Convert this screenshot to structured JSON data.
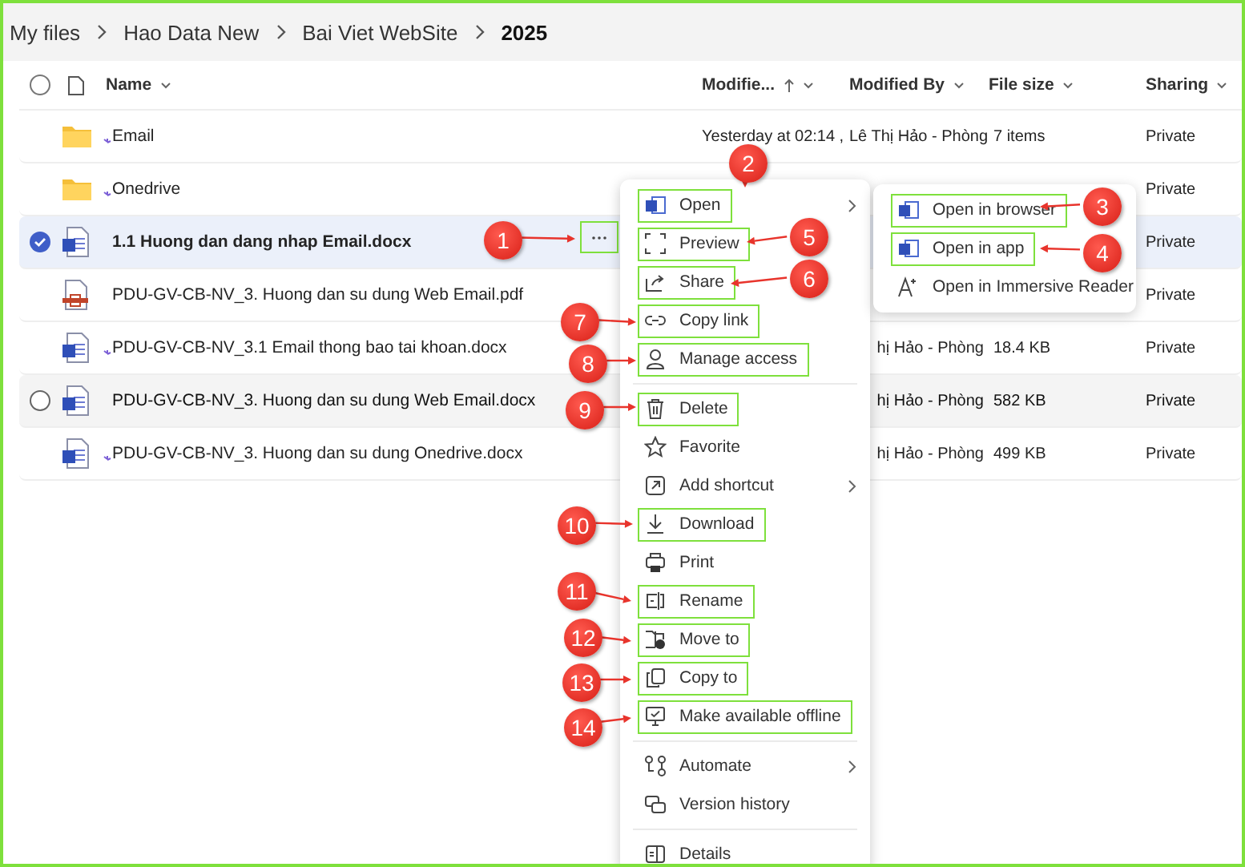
{
  "breadcrumb": [
    {
      "label": "My files",
      "current": false
    },
    {
      "label": "Hao Data New",
      "current": false
    },
    {
      "label": "Bai Viet WebSite",
      "current": false
    },
    {
      "label": "2025",
      "current": true
    }
  ],
  "table": {
    "columns": [
      {
        "label": "Name",
        "sorted": false
      },
      {
        "label": "Modifie...",
        "sorted": true
      },
      {
        "label": "Modified By",
        "sorted": false
      },
      {
        "label": "File size",
        "sorted": false
      },
      {
        "label": "Sharing",
        "sorted": false
      }
    ],
    "rows": [
      {
        "name": "Email",
        "kind": "folder",
        "new": true,
        "selected": false,
        "hovered": false,
        "modified": "Yesterday at 02:14 ,",
        "modified_by": "Lê Thị Hảo - Phòng",
        "file_size": "7 items",
        "sharing": "Private"
      },
      {
        "name": "Onedrive",
        "kind": "folder",
        "new": true,
        "selected": false,
        "hovered": false,
        "sharing": "Private"
      },
      {
        "name": "1.1 Huong dan dang nhap Email.docx",
        "kind": "word",
        "new": false,
        "selected": true,
        "hovered": false,
        "sharing": "Private"
      },
      {
        "name": "PDU-GV-CB-NV_3. Huong dan su dung Web Email.pdf",
        "kind": "pdf",
        "new": false,
        "selected": false,
        "hovered": false,
        "sharing": "Private"
      },
      {
        "name": "PDU-GV-CB-NV_3.1 Email thong bao tai khoan.docx",
        "kind": "word",
        "new": true,
        "selected": false,
        "hovered": false,
        "modified_by": "hị Hảo - Phòng",
        "file_size": "18.4 KB",
        "sharing": "Private"
      },
      {
        "name": "PDU-GV-CB-NV_3. Huong dan su dung Web Email.docx",
        "kind": "word",
        "new": false,
        "selected": false,
        "hovered": true,
        "modified_by": "hị Hảo - Phòng",
        "file_size": "582 KB",
        "sharing": "Private"
      },
      {
        "name": "PDU-GV-CB-NV_3. Huong dan su dung Onedrive.docx",
        "kind": "word",
        "new": true,
        "selected": false,
        "hovered": false,
        "modified_by": "hị Hảo - Phòng",
        "file_size": "499 KB",
        "sharing": "Private"
      }
    ]
  },
  "menu": {
    "groups": [
      [
        {
          "label": "Open",
          "highlighted": true,
          "submenu": true
        },
        {
          "label": "Preview",
          "highlighted": true,
          "submenu": false
        },
        {
          "label": "Share",
          "highlighted": true,
          "submenu": false
        },
        {
          "label": "Copy link",
          "highlighted": true,
          "submenu": false
        },
        {
          "label": "Manage access",
          "highlighted": true,
          "submenu": false
        }
      ],
      [
        {
          "label": "Delete",
          "highlighted": true,
          "submenu": false
        },
        {
          "label": "Favorite",
          "highlighted": false,
          "submenu": false
        },
        {
          "label": "Add shortcut",
          "highlighted": false,
          "submenu": true
        },
        {
          "label": "Download",
          "highlighted": true,
          "submenu": false
        },
        {
          "label": "Print",
          "highlighted": false,
          "submenu": false
        },
        {
          "label": "Rename",
          "highlighted": true,
          "submenu": false
        },
        {
          "label": "Move to",
          "highlighted": true,
          "submenu": false
        },
        {
          "label": "Copy to",
          "highlighted": true,
          "submenu": false
        },
        {
          "label": "Make available offline",
          "highlighted": true,
          "submenu": false
        }
      ],
      [
        {
          "label": "Automate",
          "highlighted": false,
          "submenu": true
        },
        {
          "label": "Version history",
          "highlighted": false,
          "submenu": false
        }
      ],
      [
        {
          "label": "Details",
          "highlighted": false,
          "submenu": false
        }
      ]
    ]
  },
  "submenu": {
    "items": [
      {
        "label": "Open in browser",
        "highlighted": true
      },
      {
        "label": "Open in app",
        "highlighted": true
      },
      {
        "label": "Open in Immersive Reader",
        "highlighted": false
      }
    ]
  },
  "callouts": [
    "1",
    "2",
    "3",
    "4",
    "5",
    "6",
    "7",
    "8",
    "9",
    "10",
    "11",
    "12",
    "13",
    "14"
  ]
}
